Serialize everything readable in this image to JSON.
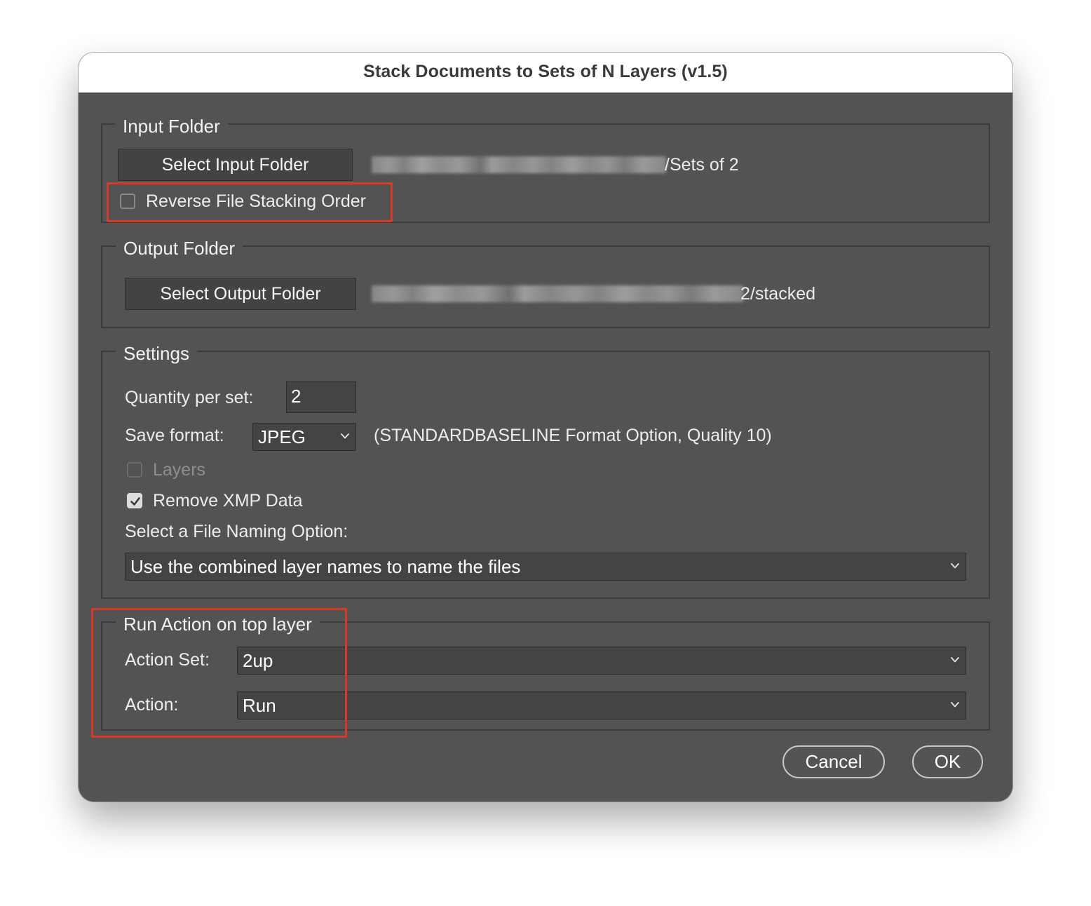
{
  "window": {
    "title": "Stack Documents to Sets of N Layers (v1.5)"
  },
  "input_folder": {
    "legend": "Input Folder",
    "button_label": "Select Input Folder",
    "path_suffix": "/Sets of 2",
    "reverse_checkbox_label": "Reverse File Stacking Order",
    "reverse_checked": false
  },
  "output_folder": {
    "legend": "Output Folder",
    "button_label": "Select Output Folder",
    "path_suffix": "2/stacked"
  },
  "settings": {
    "legend": "Settings",
    "quantity_label": "Quantity per set:",
    "quantity_value": "2",
    "save_format_label": "Save format:",
    "save_format_value": "JPEG",
    "format_note": "(STANDARDBASELINE Format Option, Quality 10)",
    "layers_label": "Layers",
    "layers_checked": false,
    "layers_enabled": false,
    "remove_xmp_label": "Remove XMP Data",
    "remove_xmp_checked": true,
    "naming_label": "Select a File Naming Option:",
    "naming_value": "Use the combined layer names to name the files"
  },
  "run_action": {
    "legend": "Run Action on top layer",
    "action_set_label": "Action Set:",
    "action_set_value": "2up",
    "action_label": "Action:",
    "action_value": "Run"
  },
  "buttons": {
    "cancel": "Cancel",
    "ok": "OK"
  },
  "colors": {
    "dialog_background": "#535353",
    "highlight_annotation": "#d63b2a"
  },
  "icons": {
    "dropdown": "chevron-down-icon",
    "checkmark": "checkmark-icon"
  }
}
